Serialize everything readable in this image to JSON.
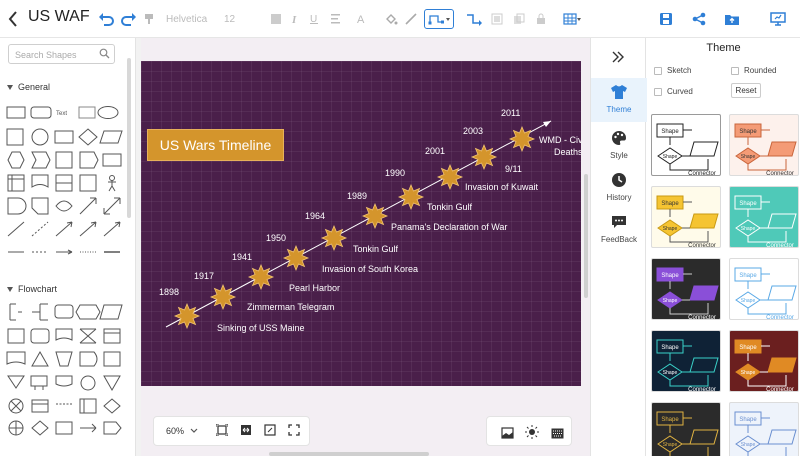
{
  "app": {
    "title": "US WAF",
    "font_name": "Helvetica",
    "font_size": "12"
  },
  "left_panel": {
    "search_placeholder": "Search Shapes",
    "section_general": "General",
    "section_flowchart": "Flowchart",
    "general_text_label": "Text"
  },
  "diagram": {
    "title": "US Wars Timeline",
    "colors": {
      "background": "#4a1f4a",
      "star": "#d4952c",
      "title_bg": "#d4952c",
      "text": "#ffffff"
    },
    "years": [
      "1898",
      "1917",
      "1941",
      "1950",
      "1964",
      "1989",
      "1990",
      "2001",
      "2003",
      "2011"
    ],
    "events": [
      "Sinking of USS Maine",
      "Zimmerman Telegram",
      "Pearl Harbor",
      "Invasion of South Korea",
      "Tonkin Gulf",
      "Panama's Declaration of War",
      "Tonkin Gulf",
      "Invasion of Kuwait",
      "9/11",
      "WMD - Civ",
      "Deaths"
    ]
  },
  "zoom": {
    "level": "60%"
  },
  "sidenav": {
    "collapse_icon": "double-chevron-right-icon",
    "items": [
      {
        "label": "Theme",
        "icon": "shirt-icon"
      },
      {
        "label": "Style",
        "icon": "palette-icon"
      },
      {
        "label": "History",
        "icon": "clock-icon"
      },
      {
        "label": "FeedBack",
        "icon": "feedback-icon"
      }
    ]
  },
  "theme_panel": {
    "title": "Theme",
    "options": {
      "sketch": "Sketch",
      "rounded": "Rounded",
      "curved": "Curved"
    },
    "reset_label": "Reset",
    "card_shape_label": "Shape",
    "card_connector_label": "Connector",
    "cards": [
      {
        "bg": "#ffffff",
        "fill": "#ffffff",
        "stroke": "#222222",
        "line": "#222222",
        "text": "#222222",
        "selected": true
      },
      {
        "bg": "#fdf1ec",
        "fill": "#f49b76",
        "stroke": "#c9653b",
        "line": "#c9653b",
        "text": "#333333",
        "selected": false
      },
      {
        "bg": "#fffbea",
        "fill": "#f5c432",
        "stroke": "#c99a13",
        "line": "#555555",
        "text": "#333333",
        "selected": false
      },
      {
        "bg": "#4fc9b8",
        "fill": "#4fc9b8",
        "stroke": "#ffffff",
        "line": "#ffffff",
        "text": "#ffffff",
        "selected": false
      },
      {
        "bg": "#2b2b2b",
        "fill": "#8a4fd8",
        "stroke": "#8a4fd8",
        "line": "#cccccc",
        "text": "#ffffff",
        "selected": false
      },
      {
        "bg": "#ffffff",
        "fill": "#ffffff",
        "stroke": "#5aa9e6",
        "line": "#5aa9e6",
        "text": "#5aa9e6",
        "selected": false
      },
      {
        "bg": "#0f2236",
        "fill": "#0f2236",
        "stroke": "#3ad1c9",
        "line": "#3ad1c9",
        "text": "#ffffff",
        "selected": false
      },
      {
        "bg": "#6b1f1f",
        "fill": "#e08a24",
        "stroke": "#e08a24",
        "line": "#ffffff",
        "text": "#ffffff",
        "selected": false
      },
      {
        "bg": "#2b2b2b",
        "fill": "#2b2b2b",
        "stroke": "#e0b341",
        "line": "#e0b341",
        "text": "#e0b341",
        "selected": false
      },
      {
        "bg": "#eef3fb",
        "fill": "#eef3fb",
        "stroke": "#6a8fd0",
        "line": "#6a8fd0",
        "text": "#6a8fd0",
        "selected": false
      }
    ]
  }
}
